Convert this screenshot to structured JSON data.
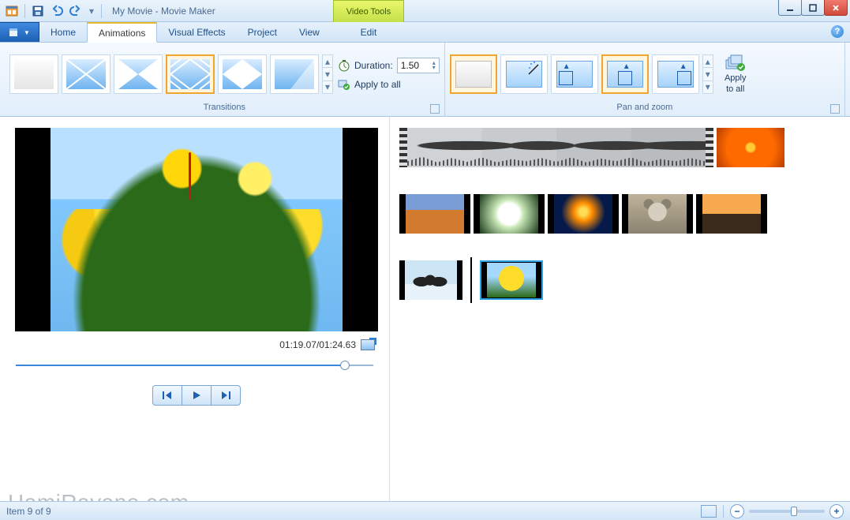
{
  "title": "My Movie - Movie Maker",
  "context_tab": {
    "group": "Video Tools",
    "tab": "Edit"
  },
  "tabs": {
    "home": "Home",
    "animations": "Animations",
    "visual_effects": "Visual Effects",
    "project": "Project",
    "view": "View",
    "active": "animations"
  },
  "ribbon": {
    "transitions": {
      "label": "Transitions",
      "duration_label": "Duration:",
      "duration_value": "1.50",
      "apply_all": "Apply to all",
      "selected_index": 3
    },
    "panzoom": {
      "label": "Pan and zoom",
      "apply_all_line1": "Apply",
      "apply_all_line2": "to all",
      "selected_index": 3
    }
  },
  "preview": {
    "time": "01:19.07/01:24.63",
    "seek_percent": 92
  },
  "status": {
    "item_text": "Item 9 of 9",
    "zoom_percent": 55
  },
  "watermark": "HamiRayane.com"
}
